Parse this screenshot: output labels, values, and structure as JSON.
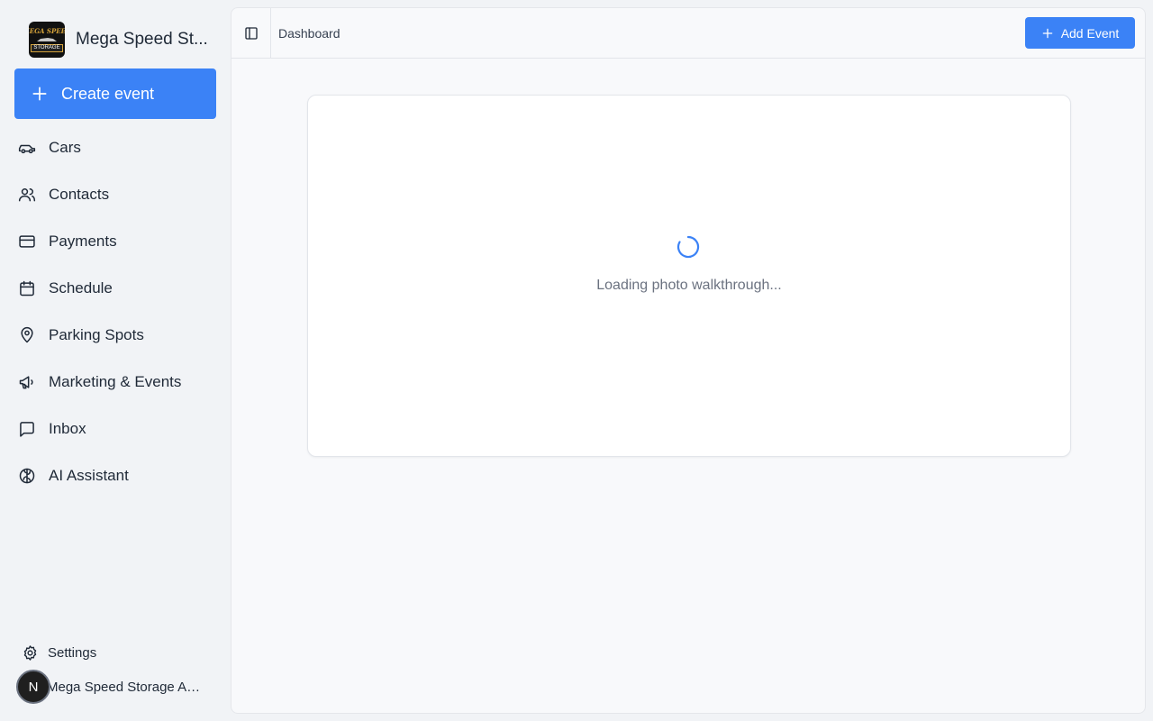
{
  "sidebar": {
    "brand_name": "Mega Speed St...",
    "logo": {
      "line1": "MEGA SPEED",
      "line3": "STORAGE"
    },
    "create_label": "Create event",
    "items": [
      {
        "label": "Cars",
        "icon": "car-icon"
      },
      {
        "label": "Contacts",
        "icon": "users-icon"
      },
      {
        "label": "Payments",
        "icon": "credit-card-icon"
      },
      {
        "label": "Schedule",
        "icon": "calendar-icon"
      },
      {
        "label": "Parking Spots",
        "icon": "map-pin-icon"
      },
      {
        "label": "Marketing & Events",
        "icon": "megaphone-icon"
      },
      {
        "label": "Inbox",
        "icon": "message-square-icon"
      },
      {
        "label": "AI Assistant",
        "icon": "brain-icon"
      }
    ],
    "settings_label": "Settings",
    "user": {
      "avatar_letter": "N",
      "name": "Mega Speed Storage Ad..."
    }
  },
  "header": {
    "breadcrumb": "Dashboard",
    "add_label": "Add Event"
  },
  "main": {
    "loading_text": "Loading photo walkthrough..."
  },
  "colors": {
    "accent": "#3b82f6",
    "sidebar_bg": "#f1f3f6",
    "main_bg": "#f8f9fb"
  }
}
